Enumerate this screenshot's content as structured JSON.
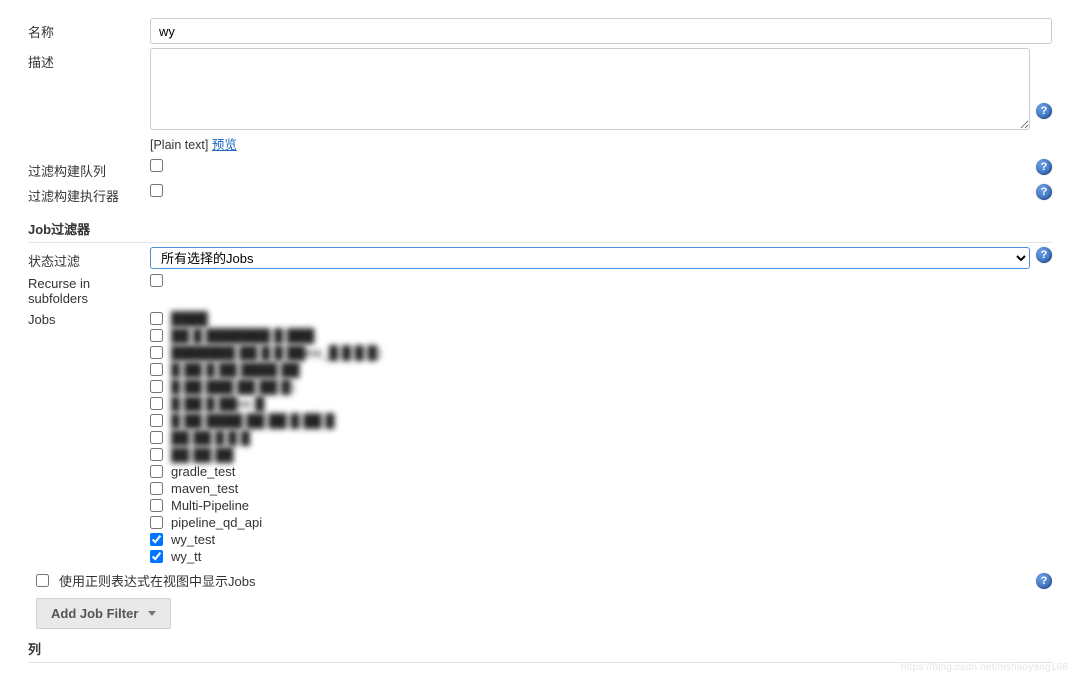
{
  "labels": {
    "name": "名称",
    "description": "描述",
    "desc_hint_prefix": "[Plain text] ",
    "desc_hint_link": "预览",
    "filter_queue": "过滤构建队列",
    "filter_executors": "过滤构建执行器",
    "section_job_filter": "Job过滤器",
    "status_filter": "状态过滤",
    "recurse": "Recurse in subfolders",
    "jobs": "Jobs",
    "use_regex": "使用正则表达式在视图中显示Jobs",
    "add_job_filter": "Add Job Filter",
    "columns": "列"
  },
  "values": {
    "name": "wy",
    "description": "",
    "filter_queue": false,
    "filter_executors": false,
    "status_filter_selected": "所有选择的Jobs",
    "recurse": false,
    "use_regex": false
  },
  "jobs": [
    {
      "label": "████",
      "checked": false,
      "blur": true
    },
    {
      "label": "██ █ ███████ █  ███",
      "checked": false,
      "blur": true
    },
    {
      "label": "███████ ██ █ █ ██ew_█ █ █ █)",
      "checked": false,
      "blur": true
    },
    {
      "label": "█ ██  █ ██ ████ ██",
      "checked": false,
      "blur": true
    },
    {
      "label": "█  ██  ███ ██   ██ █)",
      "checked": false,
      "blur": true
    },
    {
      "label": "█ ██  █ ██ee  █",
      "checked": false,
      "blur": true
    },
    {
      "label": "█ ██  ████ ██ ██  █ ██  █",
      "checked": false,
      "blur": true
    },
    {
      "label": "██ ██ █ █ █",
      "checked": false,
      "blur": true
    },
    {
      "label": "██ ██ ██",
      "checked": false,
      "blur": true
    },
    {
      "label": "gradle_test",
      "checked": false,
      "blur": false
    },
    {
      "label": "maven_test",
      "checked": false,
      "blur": false
    },
    {
      "label": "Multi-Pipeline",
      "checked": false,
      "blur": false
    },
    {
      "label": "pipeline_qd_api",
      "checked": false,
      "blur": false
    },
    {
      "label": "wy_test",
      "checked": true,
      "blur": false
    },
    {
      "label": "wy_tt",
      "checked": true,
      "blur": false
    }
  ],
  "watermark": "https://blog.csdn.net/nishaoyang168"
}
